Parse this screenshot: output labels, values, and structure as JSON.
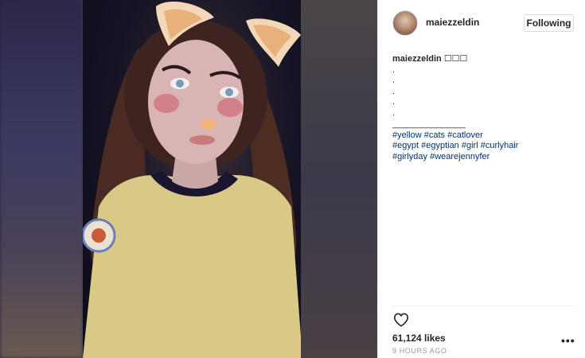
{
  "post": {
    "username": "maiezzeldin",
    "follow_label": "Following",
    "caption": {
      "username": "maiezzeldin",
      "text": "☐☐☐",
      "dots": [
        ".",
        ".",
        ".",
        ".",
        "."
      ],
      "separator": "_______________",
      "tags": [
        [
          "#yellow",
          "#cats",
          "#catlover"
        ],
        [
          "#egypt",
          "#egyptian",
          "#girl",
          "#curlyhair"
        ],
        [
          "#girlyday",
          "#wearejennyfer"
        ]
      ]
    },
    "likes": "61,124 likes",
    "timestamp": "9 HOURS AGO",
    "more_label": "•••"
  },
  "icons": {
    "like": "heart-icon",
    "more": "more-options-icon"
  },
  "colors": {
    "link": "#003569",
    "text": "#262626",
    "muted": "#999999",
    "border": "#dbdbdb"
  }
}
